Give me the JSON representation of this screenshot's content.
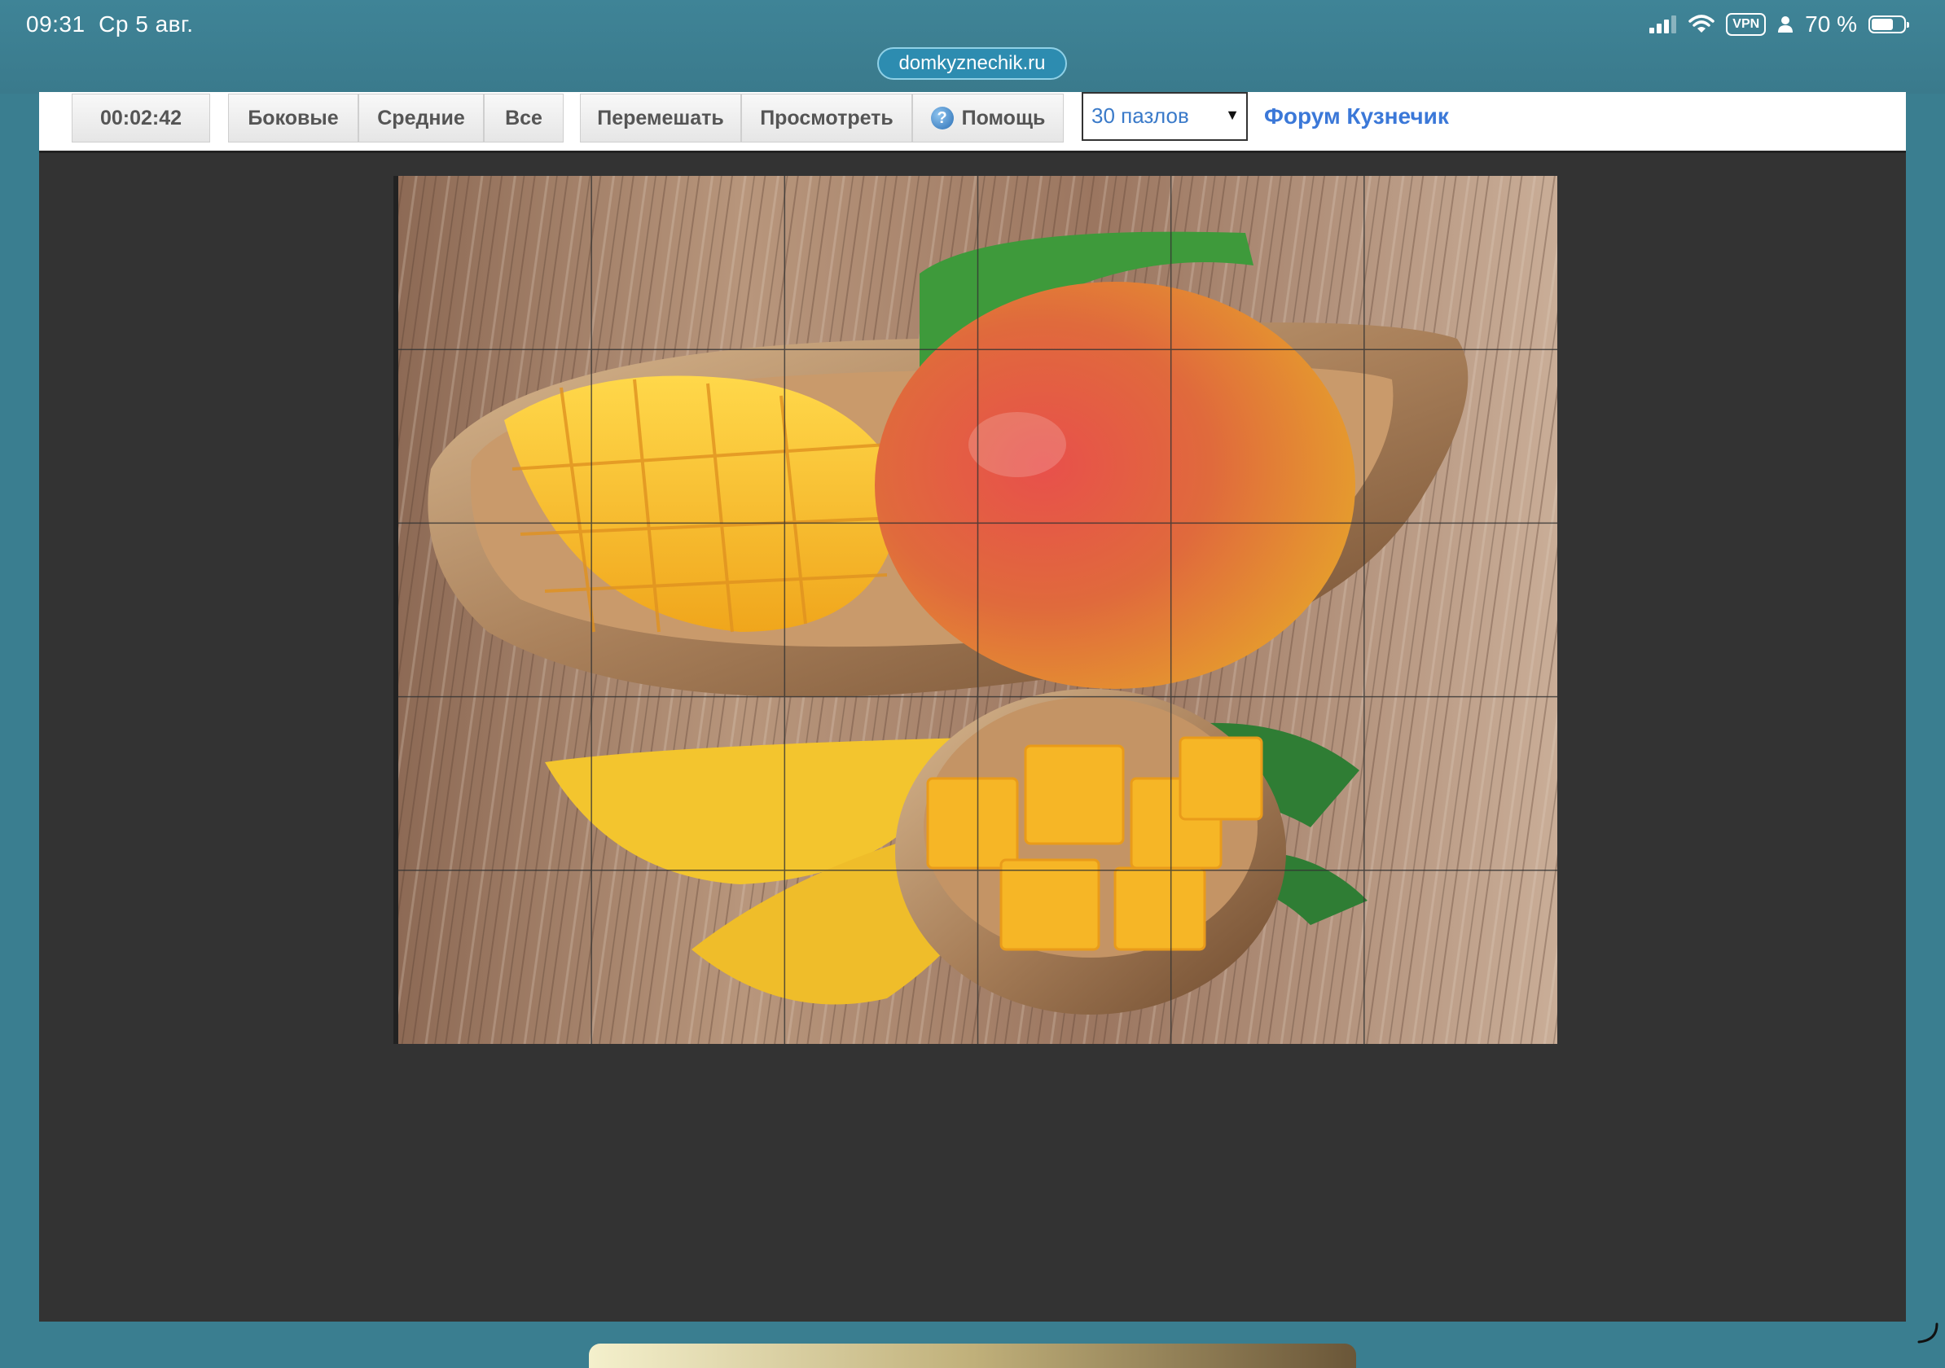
{
  "status_bar": {
    "time": "09:31",
    "date": "Ср 5 авг.",
    "vpn": "VPN",
    "battery": "70 %",
    "battery_level": 0.7
  },
  "browser": {
    "url": "domkyznechik.ru"
  },
  "toolbar": {
    "timer": "00:02:42",
    "edges": "Боковые",
    "middle": "Средние",
    "all": "Все",
    "shuffle": "Перемешать",
    "preview": "Просмотреть",
    "help_glyph": "?",
    "help": "Помощь",
    "pieces_select": "30 пазлов",
    "select_arrow": "▼",
    "forum": "Форум Кузнечик"
  },
  "puzzle": {
    "columns": 6,
    "rows": 5,
    "image": "mango-on-wooden-table"
  },
  "icons": [
    "signal-icon",
    "wifi-icon",
    "vpn-icon",
    "person-icon",
    "battery-icon",
    "help-icon",
    "dropdown-arrow-icon",
    "resize-handle-icon"
  ]
}
